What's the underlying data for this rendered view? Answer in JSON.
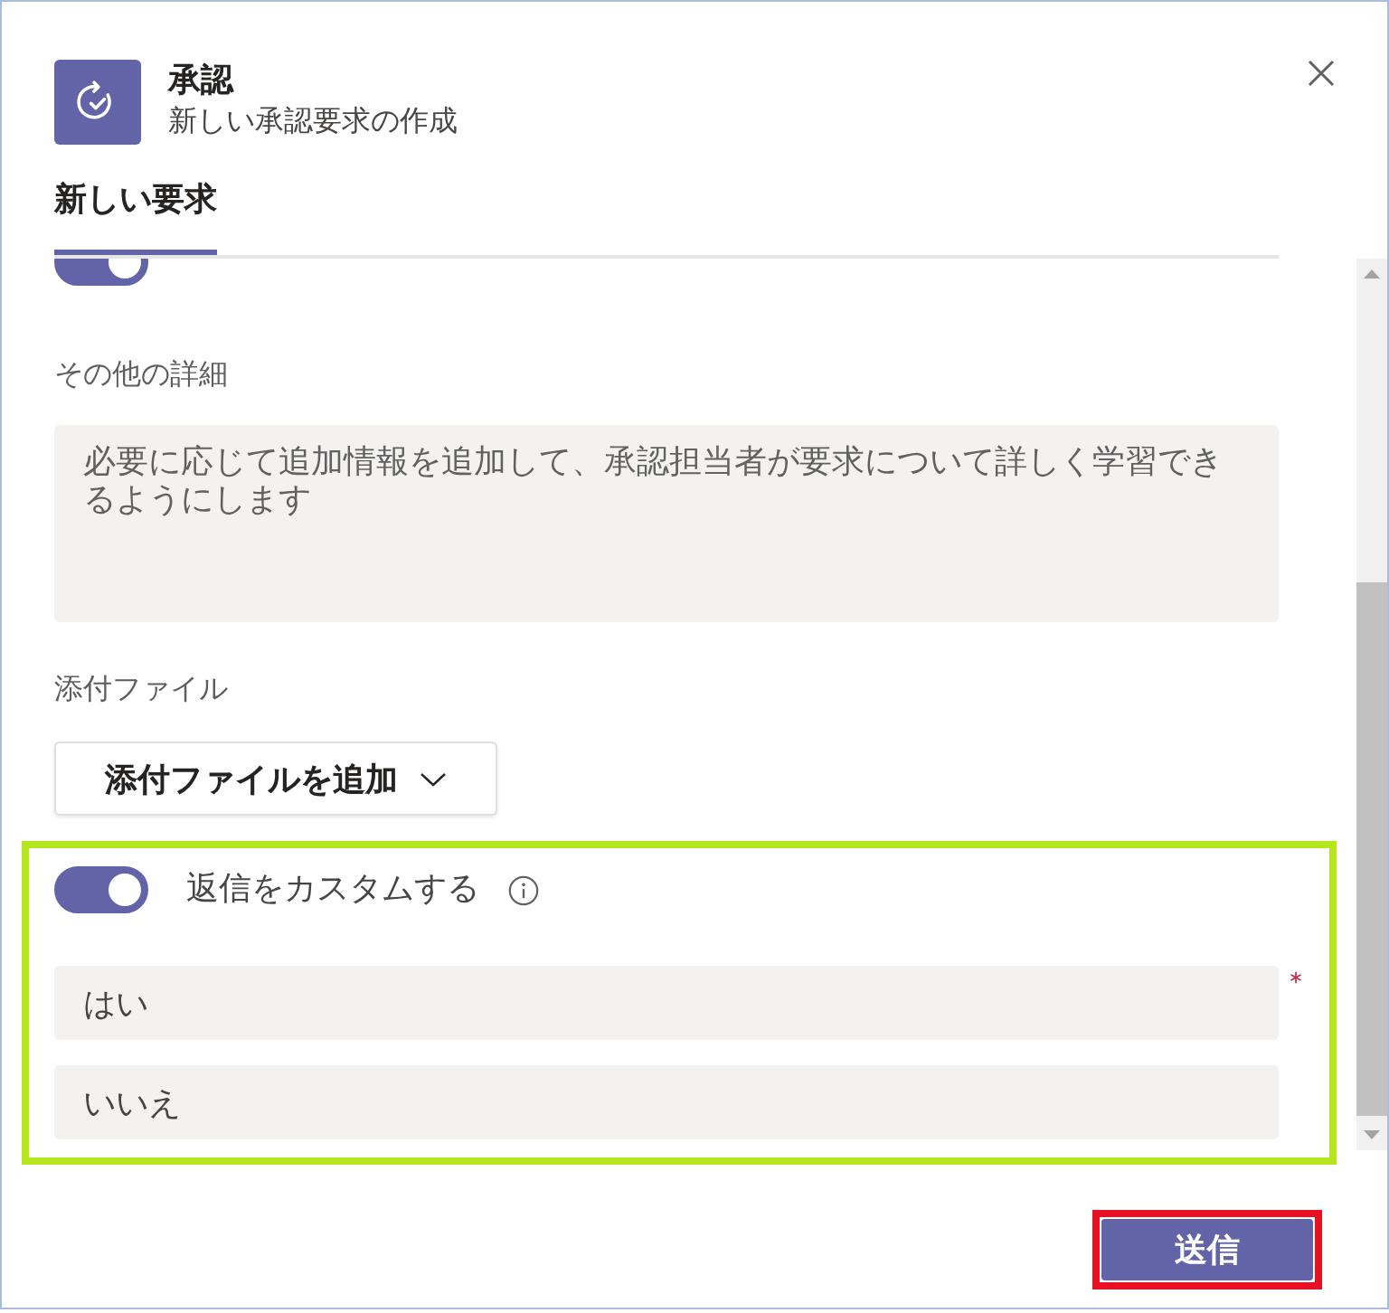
{
  "header": {
    "title": "承認",
    "subtitle": "新しい承認要求の作成"
  },
  "tabs": [
    {
      "label": "新しい要求",
      "selected": true
    }
  ],
  "form": {
    "require_all_toggle": {
      "on": true
    },
    "details": {
      "label": "その他の詳細",
      "placeholder": "必要に応じて追加情報を追加して、承認担当者が要求について詳しく学習できるようにします"
    },
    "attachments": {
      "label": "添付ファイル",
      "button": "添付ファイルを追加"
    },
    "custom_responses": {
      "highlighted": true,
      "toggle": {
        "label": "返信をカスタムする",
        "on": true
      },
      "options": [
        {
          "value": "はい",
          "required": true
        },
        {
          "value": "いいえ",
          "required": false
        }
      ]
    }
  },
  "submit_button": {
    "label": "送信",
    "highlighted": true
  }
}
